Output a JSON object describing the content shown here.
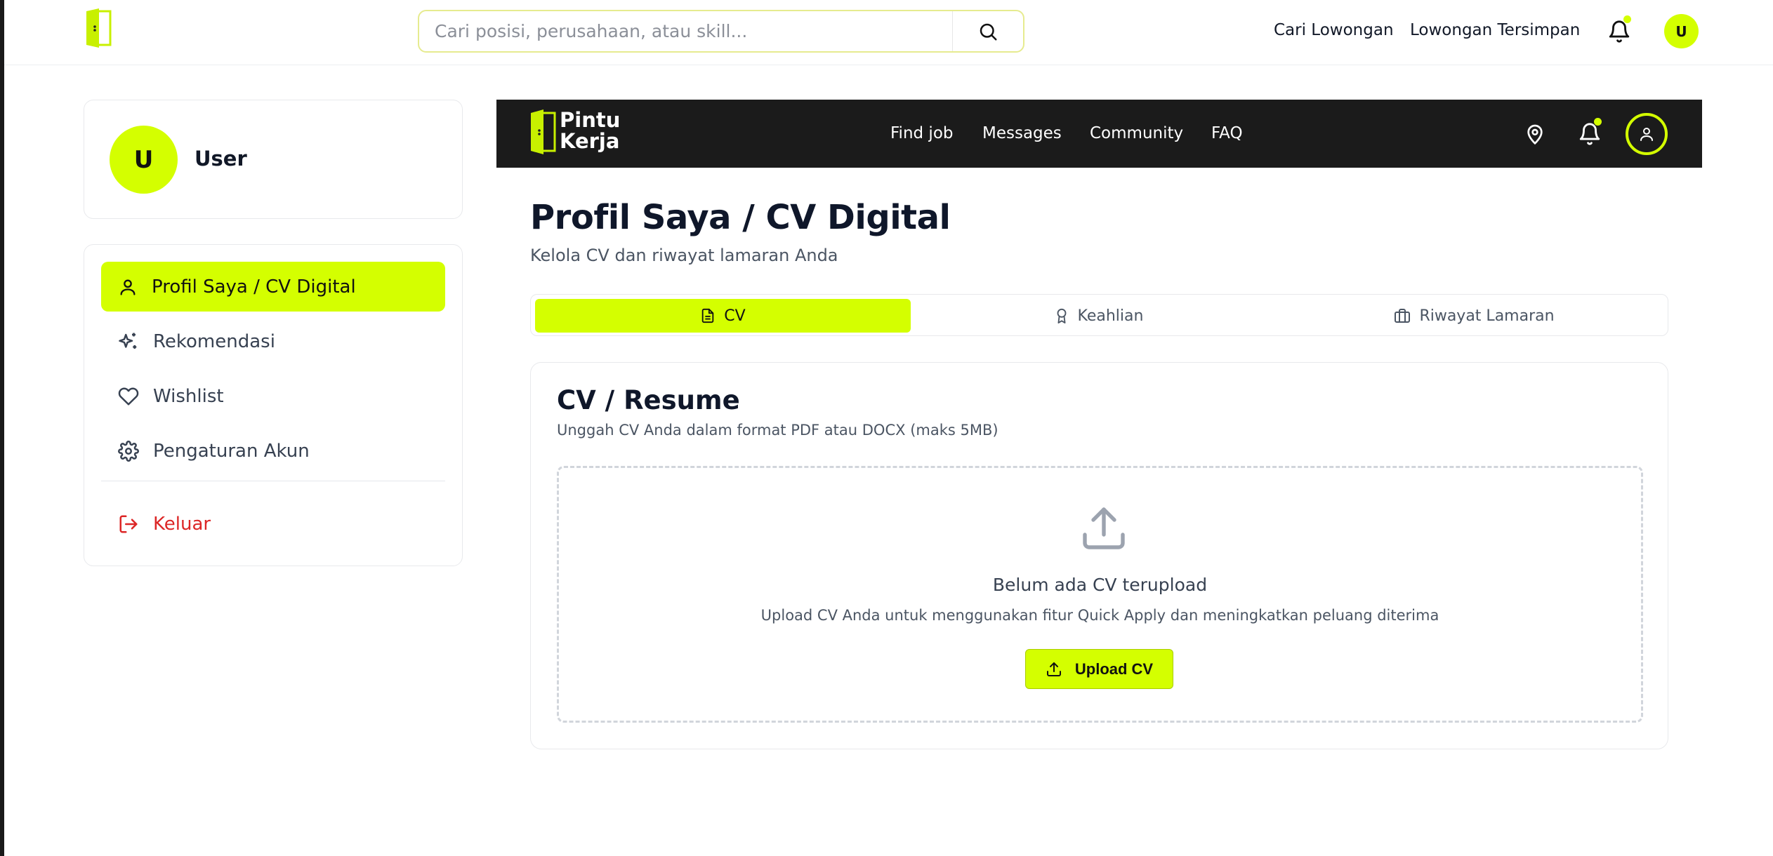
{
  "header": {
    "search_placeholder": "Cari posisi, perusahaan, atau skill...",
    "links": [
      "Cari Lowongan",
      "Lowongan Tersimpan"
    ],
    "avatar_initial": "U"
  },
  "sidebar": {
    "user": {
      "initial": "U",
      "name": "User"
    },
    "items": [
      {
        "label": "Profil Saya / CV Digital",
        "icon": "user-icon",
        "active": true
      },
      {
        "label": "Rekomendasi",
        "icon": "sparkles-icon",
        "active": false
      },
      {
        "label": "Wishlist",
        "icon": "heart-icon",
        "active": false
      },
      {
        "label": "Pengaturan Akun",
        "icon": "gear-icon",
        "active": false
      }
    ],
    "logout_label": "Keluar"
  },
  "navbar": {
    "brand_line1": "Pintu",
    "brand_line2": "Kerja",
    "links": [
      "Find job",
      "Messages",
      "Community",
      "FAQ"
    ]
  },
  "main": {
    "title": "Profil Saya / CV Digital",
    "subtitle": "Kelola CV dan riwayat lamaran Anda",
    "tabs": [
      {
        "label": "CV",
        "icon": "file-icon",
        "active": true
      },
      {
        "label": "Keahlian",
        "icon": "award-icon",
        "active": false
      },
      {
        "label": "Riwayat Lamaran",
        "icon": "briefcase-icon",
        "active": false
      }
    ],
    "cv": {
      "title": "CV / Resume",
      "description": "Unggah CV Anda dalam format PDF atau DOCX (maks 5MB)",
      "empty_title": "Belum ada CV terupload",
      "empty_description": "Upload CV Anda untuk menggunakan fitur Quick Apply dan meningkatkan peluang diterima",
      "upload_label": "Upload CV"
    }
  },
  "colors": {
    "accent": "#d4ff00",
    "navbar_bg": "#1b1b1b",
    "danger": "#dc2626"
  }
}
